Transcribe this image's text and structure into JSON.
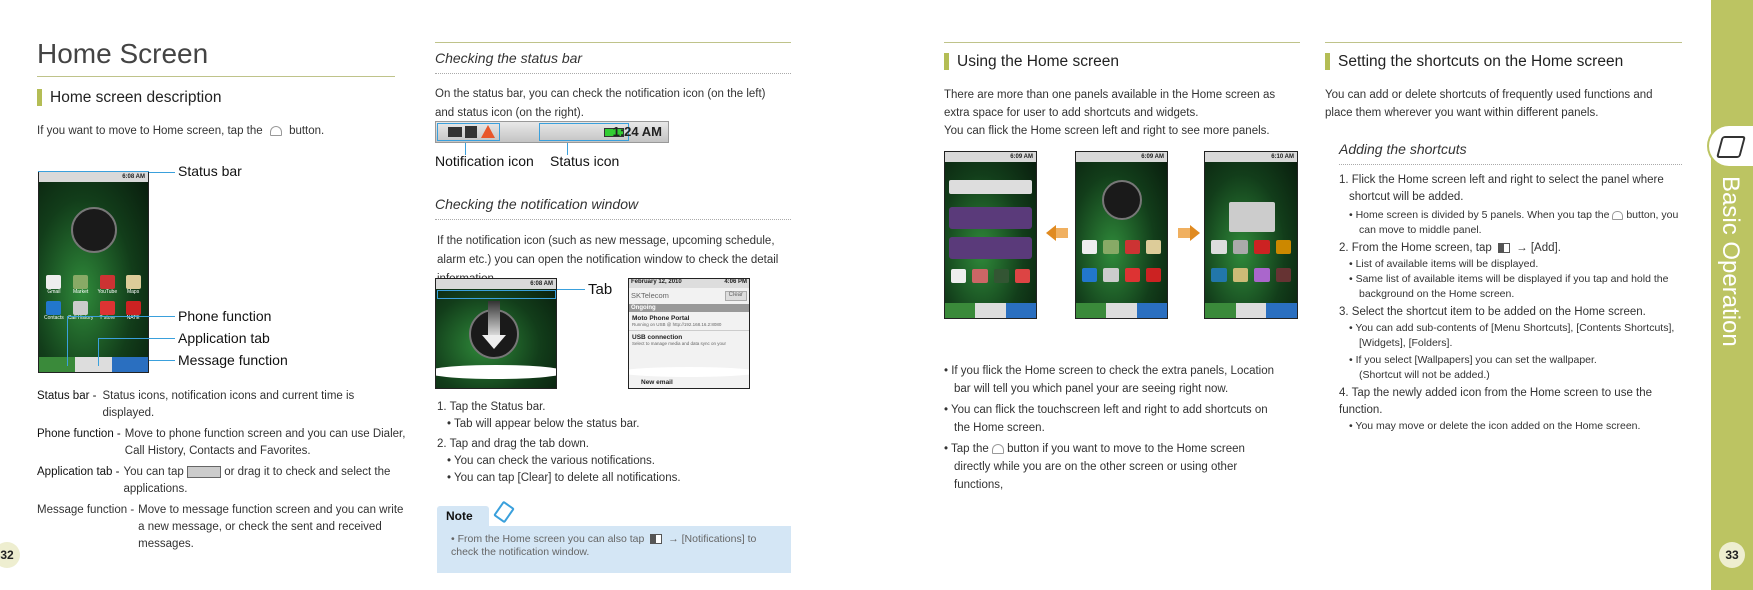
{
  "left_page": {
    "page_title": "Home Screen",
    "section_heading": "Home screen description",
    "intro": "If you want to move to Home screen, tap the",
    "intro_end": "button.",
    "callouts": [
      "Status bar",
      "Phone function",
      "Application tab",
      "Message function"
    ],
    "phone": {
      "time": "6:08 AM",
      "apps": [
        "Gmail",
        "Market",
        "YouTube",
        "Maps",
        "Contacts",
        "Call History",
        "T store",
        "NATE"
      ]
    },
    "definitions": [
      {
        "term": "Status bar -",
        "desc": "Status icons, notification icons and current time is displayed."
      },
      {
        "term": "Phone function -",
        "desc": "Move to phone function screen and you can use Dialer, Call History, Contacts and Favorites."
      },
      {
        "term": "Application tab -",
        "desc_a": "You can tap",
        "desc_b": "or drag it to check and select the applications."
      },
      {
        "term": "Message function -",
        "desc": "Move to message function screen and you can write a new message, or check the sent and received messages."
      }
    ],
    "page_number": "32",
    "status_bar_section": {
      "heading": "Checking the status bar",
      "text": "On the status bar, you can check the notification icon (on the left) and status icon (on the right).",
      "time": "1:24 AM",
      "label_notification": "Notification icon",
      "label_status": "Status icon"
    },
    "notification_section": {
      "heading": "Checking the notification window",
      "text": "If the notification icon (such as new message, upcoming schedule, alarm etc.) you can open the notification window to check the detail information.",
      "tab_label": "Tab",
      "phone_time": "6:08 AM",
      "window": {
        "date": "February 12, 2010",
        "time": "4:06 PM",
        "carrier": "SKTelecom",
        "clear": "Clear",
        "ongoing": "Ongoing",
        "items": [
          {
            "title": "Moto Phone Portal",
            "sub": "Running on USB @ http://192.168.16.2:8080"
          },
          {
            "title": "USB connection",
            "sub": "Select to manage media and data sync on your"
          }
        ],
        "new_email": "New email"
      },
      "steps": [
        {
          "text": "1.  Tap the Status bar.",
          "bullets": [
            "• Tab will appear below the status bar."
          ]
        },
        {
          "text": "2.  Tap and drag the tab down.",
          "bullets": [
            "• You can check the various notifications.",
            "• You can tap [Clear] to delete all notifications."
          ]
        }
      ],
      "note_label": "Note",
      "note_a": "• From the Home screen you can also tap",
      "note_b": "→ [Notifications] to check the notification window."
    }
  },
  "right_page": {
    "using": {
      "heading": "Using the Home screen",
      "text1": "There are more than one panels available in the Home screen as extra space for user to add shortcuts and widgets.",
      "text2": "You can flick the Home screen left and right to see more panels.",
      "panel_times": [
        "6:09 AM",
        "6:09 AM",
        "6:10 AM"
      ],
      "bullets": [
        "• If you flick the Home screen to check the extra panels, Location bar will tell you which panel your are seeing right now.",
        "• You can flick the touchscreen left and right to add shortcuts on the Home screen."
      ],
      "bullet3_a": "• Tap the",
      "bullet3_b": "button if you want to move to the Home screen directly while you are on the other screen or using other functions,"
    },
    "shortcuts": {
      "heading": "Setting the shortcuts on the Home screen",
      "text": "You can add or delete shortcuts of frequently used functions and place them wherever you want within different panels.",
      "subheading": "Adding the shortcuts",
      "step1": "1. Flick the Home screen left and right to select the panel where shortcut will be added.",
      "step1_b_a": "• Home screen is divided by 5 panels. When you tap the",
      "step1_b_b": "button, you can move to middle panel.",
      "step2_a": "2.  From the Home screen, tap",
      "step2_b": "→ [Add].",
      "step2_bullets": [
        "• List of available items will be displayed.",
        "• Same list of available items will be displayed if you tap and hold the background on the Home screen."
      ],
      "step3": "3. Select the shortcut item to be added on the Home screen.",
      "step3_bullets": [
        "• You can add sub-contents of [Menu Shortcuts], [Contents Shortcuts], [Widgets], [Folders].",
        "• If you select [Wallpapers] you can set the wallpaper. (Shortcut will not be added.)"
      ],
      "step4": "4. Tap the newly added icon from the Home screen to use the function.",
      "step4_bullets": [
        "• You may move or delete the icon added on the Home screen."
      ]
    },
    "side_tab": "Basic Operation",
    "page_number": "33"
  },
  "colors": {
    "accent_green": "#bcc462",
    "callout_blue": "#3aa0dc",
    "note_bg": "#d4e6f5"
  }
}
